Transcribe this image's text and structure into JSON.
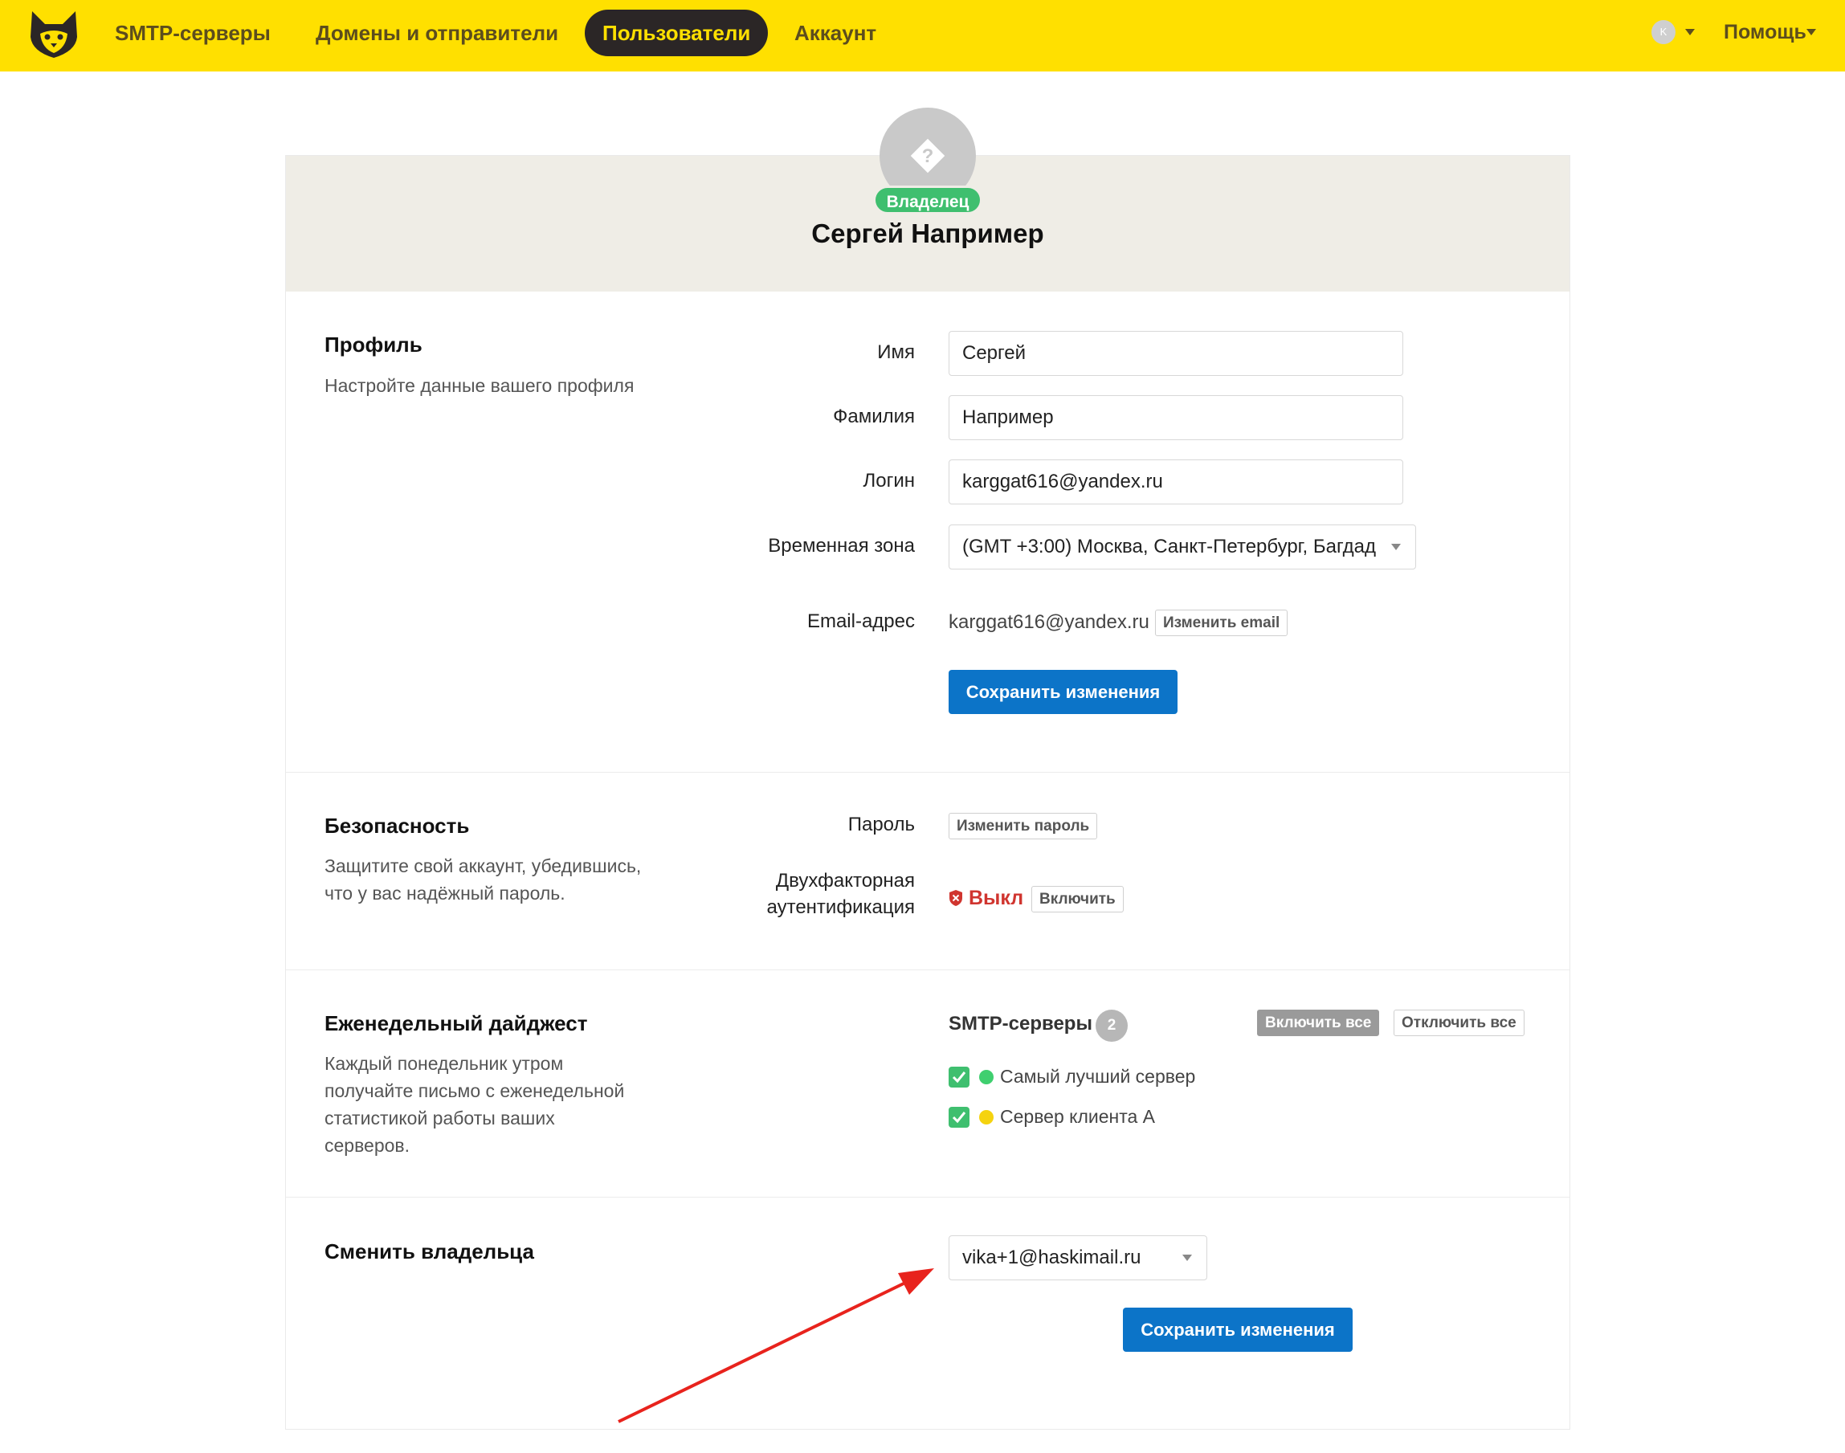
{
  "nav": {
    "logo_icon": "husky-dog-logo-icon",
    "items": [
      "SMTP-серверы",
      "Домены и отправители",
      "Пользователи",
      "Аккаунт"
    ],
    "active_index": 2,
    "user_initial": "K",
    "help_label": "Помощь"
  },
  "header": {
    "avatar_icon": "unknown-user-diamond-icon",
    "role_badge": "Владелец",
    "user_name": "Сергей Например"
  },
  "profile": {
    "title": "Профиль",
    "description": "Настройте данные вашего профиля",
    "labels": {
      "first_name": "Имя",
      "last_name": "Фамилия",
      "login": "Логин",
      "timezone": "Временная зона",
      "email": "Email-адрес"
    },
    "values": {
      "first_name": "Сергей",
      "last_name": "Например",
      "login": "karggat616@yandex.ru",
      "timezone": "(GMT +3:00) Москва, Санкт-Петербург, Багдад",
      "email": "karggat616@yandex.ru"
    },
    "change_email_label": "Изменить email",
    "save_label": "Сохранить изменения"
  },
  "security": {
    "title": "Безопасность",
    "description_line1": "Защитите свой аккаунт, убедившись,",
    "description_line2": "что у вас надёжный пароль.",
    "password_label": "Пароль",
    "change_password_label": "Изменить пароль",
    "twofa_label_line1": "Двухфакторная",
    "twofa_label_line2": "аутентификация",
    "twofa_status": "Выкл",
    "twofa_status_color": "#d0352f",
    "enable_label": "Включить"
  },
  "digest": {
    "title": "Еженедельный дайджест",
    "description_lines": [
      "Каждый понедельник утром",
      "получайте письмо с еженедельной",
      "статистикой работы ваших",
      "серверов."
    ],
    "servers_heading": "SMTP-серверы",
    "servers_count": "2",
    "enable_all_label": "Включить все",
    "disable_all_label": "Отключить все",
    "servers": [
      {
        "name": "Самый лучший сервер",
        "checked": true,
        "status_color": "#3fcf6f"
      },
      {
        "name": "Сервер клиента А",
        "checked": true,
        "status_color": "#f5d30f"
      }
    ]
  },
  "owner": {
    "title": "Сменить владельца",
    "selected_owner": "vika+1@haskimail.ru",
    "save_label": "Сохранить изменения"
  },
  "colors": {
    "topbar": "#ffe000",
    "nav_text": "#5c4d1d",
    "primary_button": "#0c74c8",
    "owner_badge": "#3fbf6f",
    "annotation_arrow": "#e8231d"
  }
}
